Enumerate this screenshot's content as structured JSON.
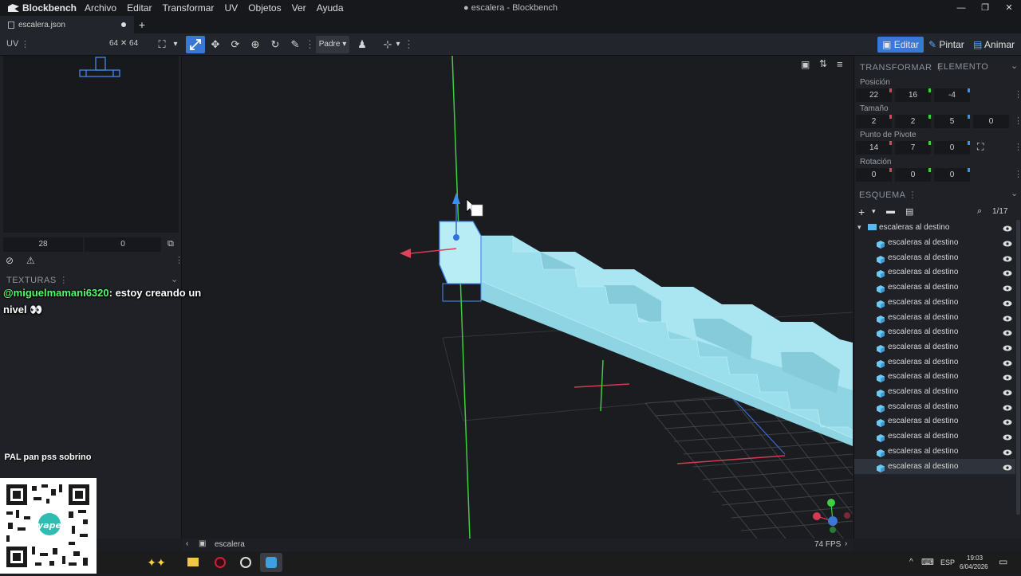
{
  "app": {
    "name": "Blockbench",
    "window_title": "● escalera - Blockbench",
    "menu": [
      "Archivo",
      "Editar",
      "Transformar",
      "UV",
      "Objetos",
      "Ver",
      "Ayuda"
    ],
    "window_controls": [
      "—",
      "❐",
      "✕"
    ]
  },
  "tabs": [
    {
      "label": "escalera.json",
      "modified": true
    }
  ],
  "toolbar": {
    "uv_label": "UV",
    "uv_size": "64 ✕ 64",
    "pivot_mode": "Padre",
    "modes": [
      "Editar",
      "Pintar",
      "Animar"
    ],
    "active_mode": "Editar"
  },
  "uv_panel": {
    "values": [
      "28",
      "0"
    ]
  },
  "textures": {
    "header": "TEXTURAS"
  },
  "transform": {
    "tabs": [
      "TRANSFORMAR",
      "ELEMENTO"
    ],
    "position": {
      "label": "Posición",
      "values": [
        "22",
        "16",
        "-4"
      ]
    },
    "size": {
      "label": "Tamaño",
      "values": [
        "2",
        "2",
        "5",
        "0"
      ]
    },
    "pivot": {
      "label": "Punto de Pivote",
      "values": [
        "14",
        "7",
        "0"
      ]
    },
    "rotation": {
      "label": "Rotación",
      "values": [
        "0",
        "0",
        "0"
      ]
    },
    "axis_colors": [
      "#e0425b",
      "#3ed13a",
      "#3b8ff0"
    ]
  },
  "outliner": {
    "header": "ESQUEMA",
    "count": "1/17",
    "group": "escaleras al destino",
    "items": [
      "escaleras al destino",
      "escaleras al destino",
      "escaleras al destino",
      "escaleras al destino",
      "escaleras al destino",
      "escaleras al destino",
      "escaleras al destino",
      "escaleras al destino",
      "escaleras al destino",
      "escaleras al destino",
      "escaleras al destino",
      "escaleras al destino",
      "escaleras al destino",
      "escaleras al destino",
      "escaleras al destino",
      "escaleras al destino"
    ],
    "selected_index": 15
  },
  "statusbar": {
    "name": "escalera",
    "fps": "74 FPS"
  },
  "overlay": {
    "chat_user": "@miguelmamani6320",
    "chat_message": ": estoy creando un nivel 👀",
    "qr_caption": "PAL pan pss sobrino",
    "qr_brand": "yape"
  },
  "taskbar": {
    "lang": "ESP",
    "time": "19:03",
    "date": "6/04/2026"
  },
  "colors": {
    "accent": "#3b78d6",
    "cube": "#a9e6f2",
    "cube_side": "#8fd4e2"
  }
}
